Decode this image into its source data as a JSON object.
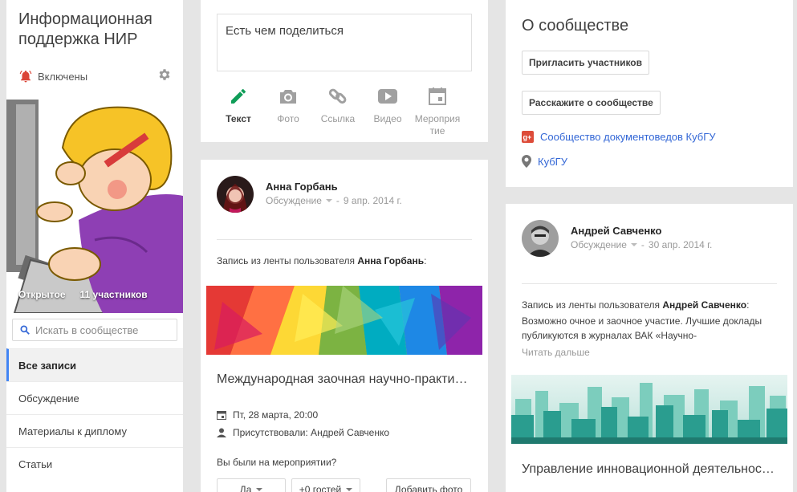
{
  "sidebar": {
    "title": "Информационная поддержка НИР",
    "notifications": "Включены",
    "cover": {
      "privacy": "Открытое",
      "members": "11 участников"
    },
    "search_placeholder": "Искать в сообществе",
    "nav": [
      {
        "label": "Все записи"
      },
      {
        "label": "Обсуждение"
      },
      {
        "label": "Материалы к диплому"
      },
      {
        "label": "Статьи"
      }
    ]
  },
  "share": {
    "placeholder": "Есть чем поделиться",
    "actions": [
      {
        "label": "Текст",
        "icon": "pencil-icon"
      },
      {
        "label": "Фото",
        "icon": "camera-icon"
      },
      {
        "label": "Ссылка",
        "icon": "link-icon"
      },
      {
        "label": "Видео",
        "icon": "video-icon"
      },
      {
        "label": "Мероприя тие",
        "icon": "event-icon"
      }
    ]
  },
  "post1": {
    "author": "Анна Горбань",
    "category": "Обсуждение",
    "date": "9 апр. 2014 г.",
    "repost_prefix": "Запись из ленты пользователя",
    "repost_author": "Анна Горбань",
    "repost_suffix": ":",
    "event_title": "Международная заочная научно-практическая конференция",
    "event_date": "Пт, 28 марта, 20:00",
    "attended": "Присутствовали: Андрей Савченко",
    "question": "Вы были на мероприятии?",
    "btn_yes": "Да",
    "btn_guests": "+0 гостей",
    "btn_add_photo": "Добавить фото"
  },
  "about": {
    "title": "О сообществе",
    "invite_button": "Пригласить участников",
    "share_button": "Расскажите о сообществе",
    "gplus_link": "Сообщество документоведов КубГУ",
    "location_link": "КубГУ"
  },
  "post2": {
    "author": "Андрей Савченко",
    "category": "Обсуждение",
    "date": "30 апр. 2014 г.",
    "repost_prefix": "Запись из ленты пользователя",
    "repost_author": "Андрей Савченко",
    "repost_suffix": ":",
    "text": "Возможно очное и заочное участие. Лучшие доклады публикуются в журналах ВАК «Научно-",
    "read_more": "Читать дальше",
    "title": "Управление инновационной деятельностью"
  },
  "colors": {
    "accent": "#4285f4",
    "link": "#3367d6",
    "green": "#0f9d58",
    "bell": "#db4437"
  }
}
